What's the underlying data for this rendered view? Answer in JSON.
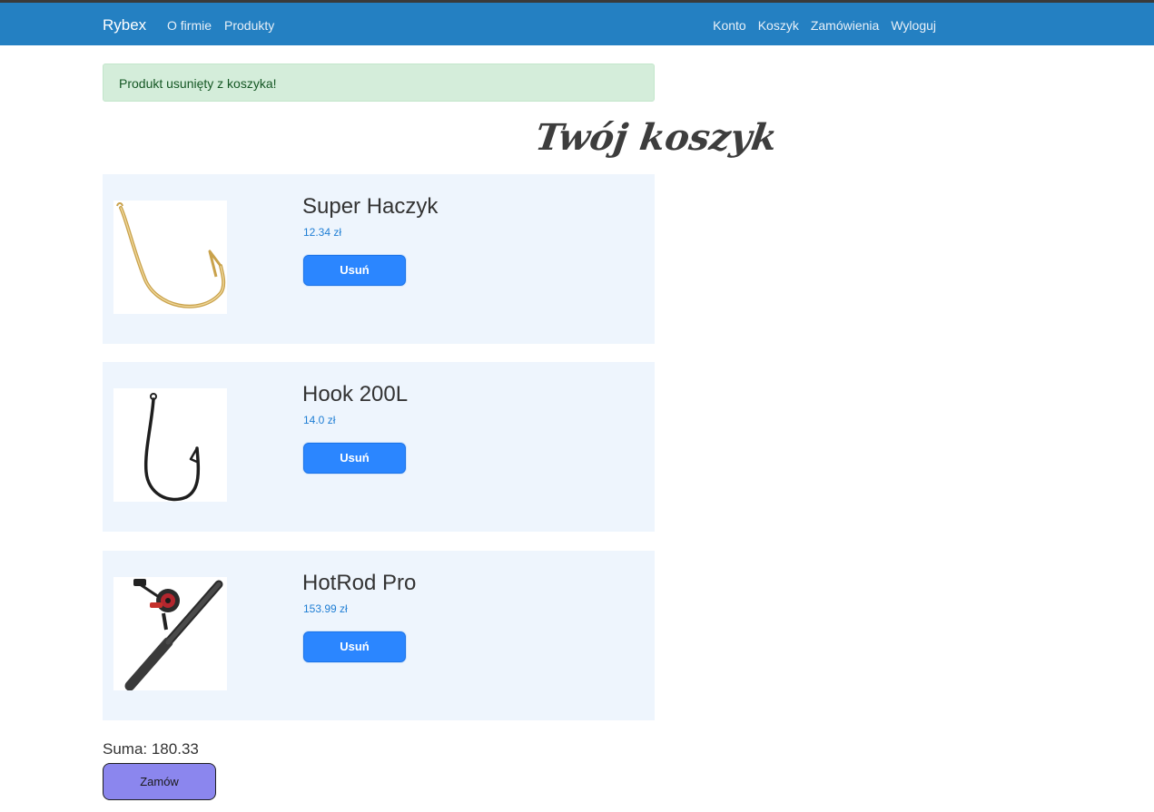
{
  "nav": {
    "brand": "Rybex",
    "left_links": [
      {
        "label": "O firmie"
      },
      {
        "label": "Produkty"
      }
    ],
    "right_links": [
      {
        "label": "Konto"
      },
      {
        "label": "Koszyk"
      },
      {
        "label": "Zamówienia"
      },
      {
        "label": "Wyloguj"
      }
    ],
    "bar_color": "#2480c2"
  },
  "alert": {
    "message": "Produkt usunięty z koszyka!"
  },
  "cart": {
    "title": "Twój koszyk",
    "items": [
      {
        "name": "Super Haczyk",
        "price": "12.34 zł",
        "remove_label": "Usuń",
        "image_icon": "gold-fishing-hook-image"
      },
      {
        "name": "Hook 200L",
        "price": "14.0 zł",
        "remove_label": "Usuń",
        "image_icon": "black-fishing-hook-image"
      },
      {
        "name": "HotRod Pro",
        "price": "153.99 zł",
        "remove_label": "Usuń",
        "image_icon": "fishing-rod-reel-image"
      }
    ],
    "sum_text": "Suma: 180.33",
    "order_label": "Zamów"
  }
}
